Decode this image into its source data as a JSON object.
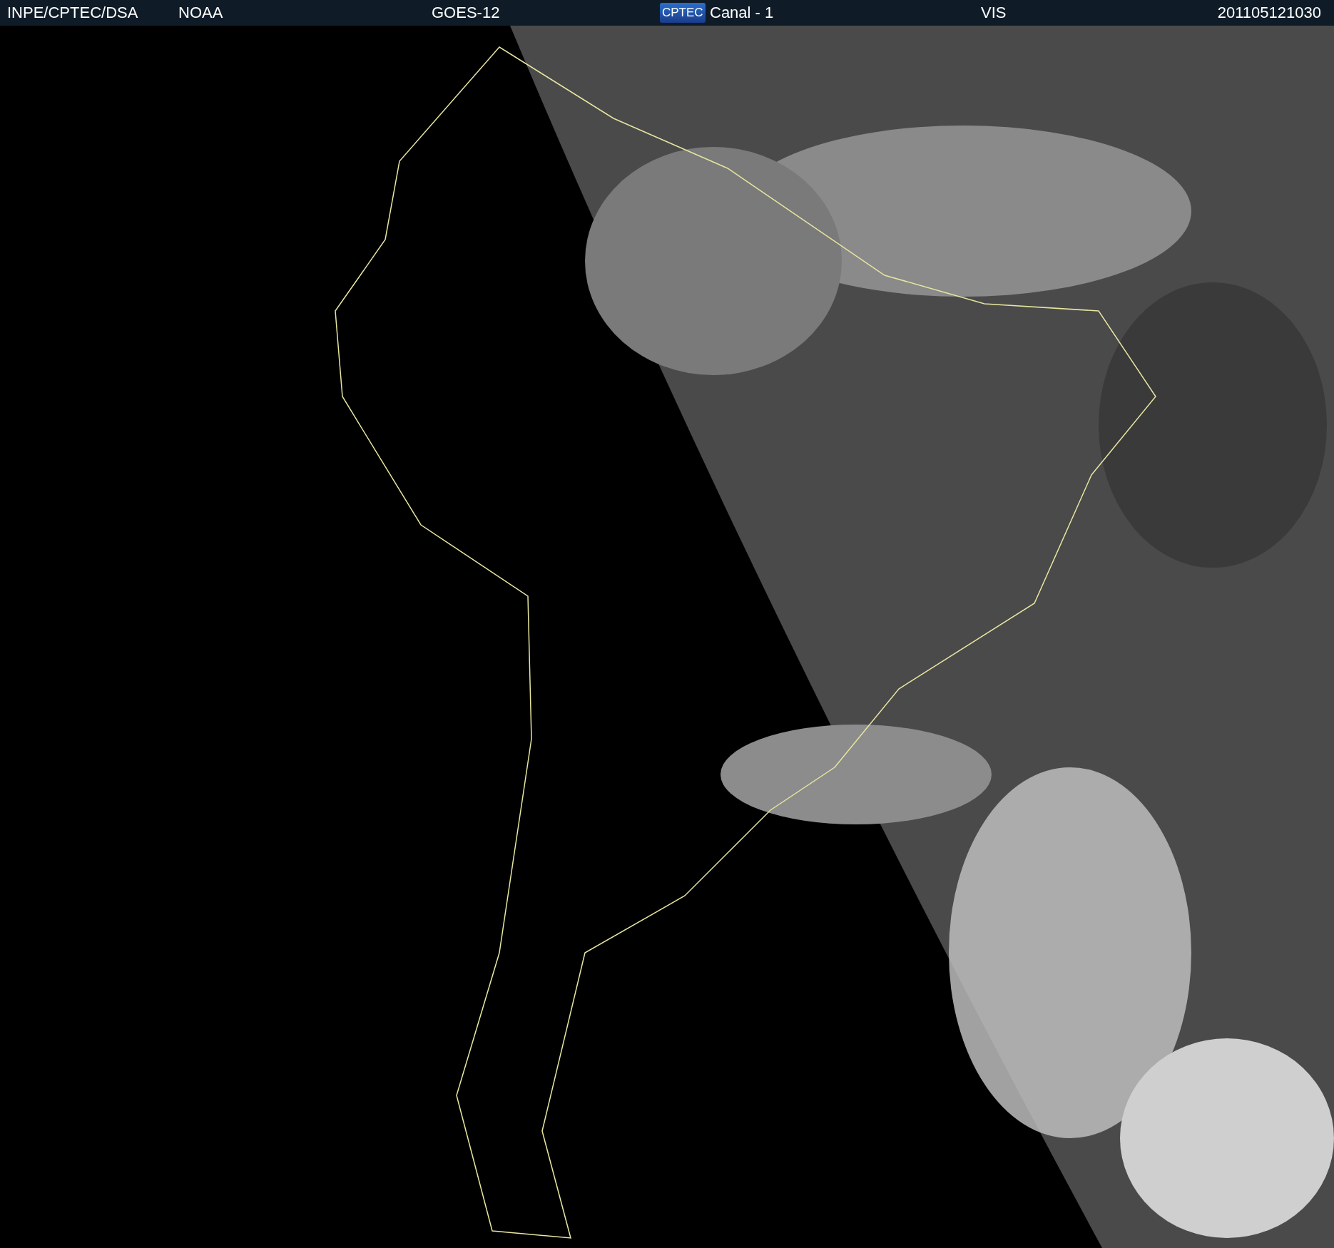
{
  "header": {
    "items": [
      {
        "kind": "text",
        "text": "INPE/CPTEC/DSA"
      },
      {
        "kind": "text",
        "text": "NOAA"
      },
      {
        "kind": "text",
        "text": "GOES-12"
      },
      {
        "kind": "logo",
        "text": "CPTEC"
      },
      {
        "kind": "text",
        "text": "Canal - 1"
      },
      {
        "kind": "text",
        "text": "VIS"
      },
      {
        "kind": "text",
        "text": "201105121030"
      }
    ]
  }
}
